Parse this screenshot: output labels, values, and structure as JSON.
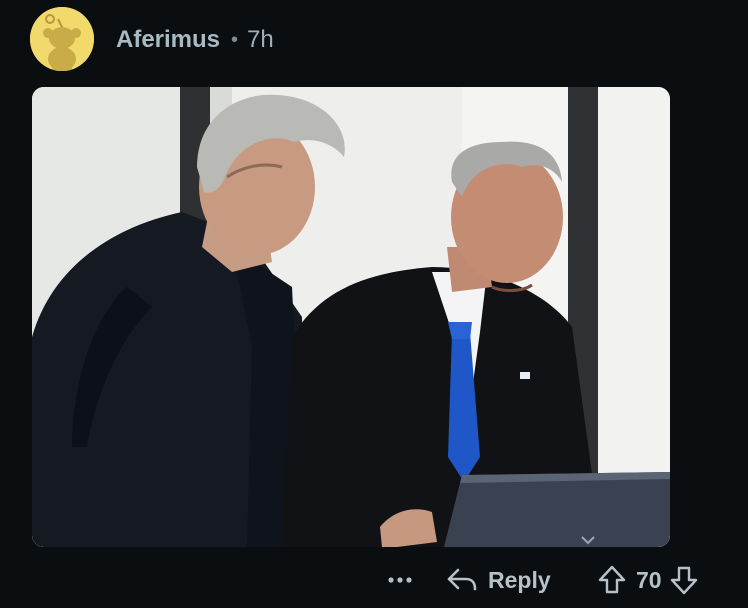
{
  "comment": {
    "author": "Aferimus",
    "separator": "•",
    "time": "7h",
    "avatar_color": "#f1d96b"
  },
  "media": {
    "icon": "photo"
  },
  "actions": {
    "more_label": "•••",
    "reply_label": "Reply",
    "score": "70",
    "icons": {
      "more": "ellipsis-icon",
      "reply": "reply-arrow-icon",
      "upvote": "arrow-up-icon",
      "downvote": "arrow-down-icon"
    }
  },
  "colors": {
    "background": "#0b0e10",
    "text": "#b6c1c8",
    "tie": "#1f57c8"
  }
}
